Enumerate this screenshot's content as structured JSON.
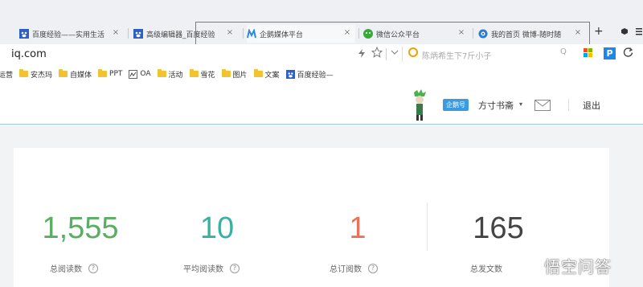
{
  "tabs": [
    {
      "label": "百度经验——实用生活",
      "icon": "baidu-icon",
      "active": false
    },
    {
      "label": "高级编辑器_百度经验",
      "icon": "baidu-icon",
      "active": false
    },
    {
      "label": "企鹅媒体平台",
      "icon": "penguin-media-icon",
      "active": true
    },
    {
      "label": "微信公众平台",
      "icon": "wechat-icon",
      "active": false
    },
    {
      "label": "我的首页 微博-随时随",
      "icon": "weibo-icon",
      "active": false
    }
  ],
  "tab_close_glyph": "×",
  "new_tab_glyph": "+",
  "address": {
    "url": "iq.com",
    "search_hint": "陈炳希生下7斤小子",
    "search_q": "Q"
  },
  "bookmarks": [
    {
      "label": "运营",
      "type": "text"
    },
    {
      "label": "安杰玛",
      "type": "folder"
    },
    {
      "label": "自媒体",
      "type": "folder"
    },
    {
      "label": "PPT",
      "type": "folder"
    },
    {
      "label": "OA",
      "type": "oa-icon"
    },
    {
      "label": "活动",
      "type": "folder"
    },
    {
      "label": "雪花",
      "type": "folder"
    },
    {
      "label": "图片",
      "type": "folder"
    },
    {
      "label": "文案",
      "type": "folder"
    },
    {
      "label": "百度经验—",
      "type": "baidu-icon"
    }
  ],
  "header": {
    "badge": "企鹅号",
    "account_name": "方寸书斋",
    "caret": "▾",
    "logout": "退出"
  },
  "stats": [
    {
      "value": "1,555",
      "label": "总阅读数",
      "color": "#5aae63"
    },
    {
      "value": "10",
      "label": "平均阅读数",
      "color": "#3ab0a0"
    },
    {
      "value": "1",
      "label": "总订阅数",
      "color": "#e8735a"
    },
    {
      "value": "165",
      "label": "总发文数",
      "color": "#444444"
    }
  ],
  "help_glyph": "?",
  "watermark": "悟空问答",
  "colors": {
    "highlight_box": "#d9534f",
    "accent_blue": "#3b9be0"
  }
}
